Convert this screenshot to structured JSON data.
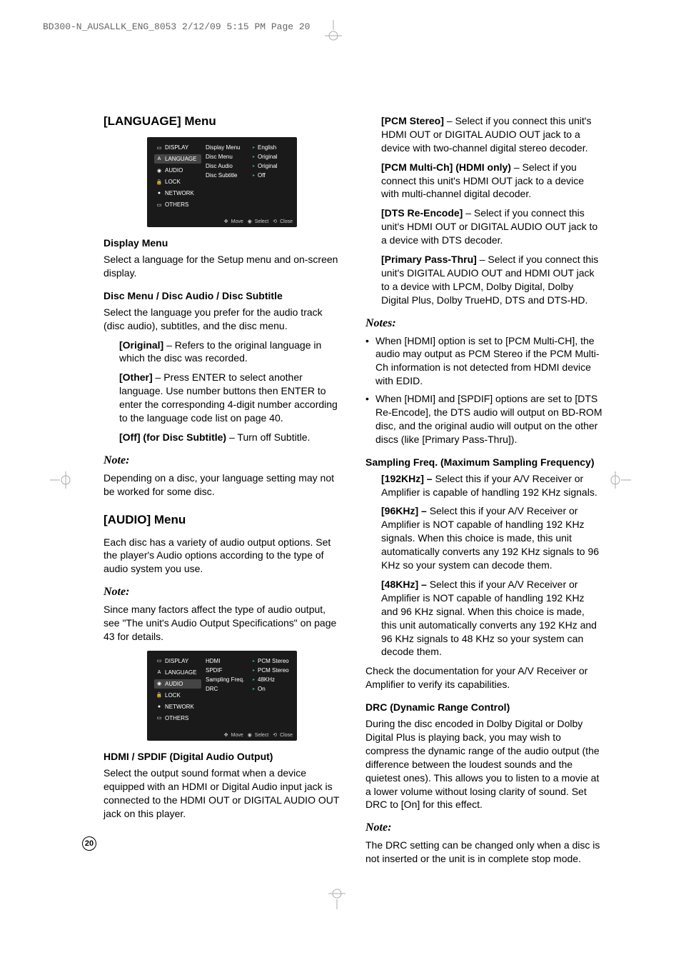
{
  "header": "BD300-N_AUSALLK_ENG_8053  2/12/09  5:15 PM  Page 20",
  "page_number": "20",
  "left": {
    "h_language": "[LANGUAGE] Menu",
    "menu1": {
      "side": [
        "DISPLAY",
        "LANGUAGE",
        "AUDIO",
        "LOCK",
        "NETWORK",
        "OTHERS"
      ],
      "mid": [
        "Display Menu",
        "Disc Menu",
        "Disc Audio",
        "Disc Subtitle"
      ],
      "right": [
        "English",
        "Original",
        "Original",
        "Off"
      ],
      "footer_move": "Move",
      "footer_select": "Select",
      "footer_close": "Close"
    },
    "dm_h": "Display Menu",
    "dm_p": "Select a language for the Setup menu and on-screen display.",
    "dmas_h": "Disc Menu / Disc Audio / Disc Subtitle",
    "dmas_p": "Select the language you prefer for the audio track (disc audio), subtitles, and the disc menu.",
    "orig_b": "[Original]",
    "orig_t": " – Refers to the original language in which the disc was recorded.",
    "other_b": "[Other]",
    "other_t": " – Press ENTER to select another language. Use number buttons then ENTER to enter the corresponding 4-digit number according to the language code list on page 40.",
    "off_b": "[Off] (for Disc Subtitle)",
    "off_t": " – Turn off Subtitle.",
    "note1_h": "Note:",
    "note1_p": "Depending on a disc, your language setting may not be worked for some disc.",
    "h_audio": "[AUDIO] Menu",
    "audio_p": "Each disc has a variety of audio output options. Set the player's Audio options according to the type of audio system you use.",
    "note2_h": "Note:",
    "note2_p": "Since many factors affect the type of audio output, see \"The unit's Audio Output Specifications\" on page 43 for details.",
    "menu2": {
      "side": [
        "DISPLAY",
        "LANGUAGE",
        "AUDIO",
        "LOCK",
        "NETWORK",
        "OTHERS"
      ],
      "mid": [
        "HDMI",
        "SPDIF",
        "Sampling Freq.",
        "DRC"
      ],
      "right": [
        "PCM Stereo",
        "PCM Stereo",
        "48KHz",
        "On"
      ],
      "footer_move": "Move",
      "footer_select": "Select",
      "footer_close": "Close"
    },
    "hs_h": "HDMI / SPDIF (Digital Audio Output)",
    "hs_p": "Select the output sound format when a device equipped with an HDMI or Digital Audio input jack is connected to the HDMI OUT or DIGITAL AUDIO OUT jack on this player."
  },
  "right": {
    "pcm_b": "[PCM Stereo]",
    "pcm_t": " – Select if you connect this unit's HDMI OUT or DIGITAL AUDIO OUT jack to a device with two-channel digital stereo decoder.",
    "pcmm_b": "[PCM Multi-Ch] (HDMI only)",
    "pcmm_t": " – Select if you connect this unit's HDMI OUT jack to a device with multi-channel digital decoder.",
    "dts_b": "[DTS Re-Encode]",
    "dts_t": " – Select if you connect this unit's HDMI OUT or DIGITAL AUDIO OUT jack to a device with DTS decoder.",
    "pri_b": "[Primary Pass-Thru]",
    "pri_t": " – Select if you connect this unit's DIGITAL AUDIO OUT and HDMI OUT jack to a device with LPCM, Dolby Digital, Dolby Digital Plus, Dolby TrueHD, DTS and DTS-HD.",
    "notes_h": "Notes:",
    "note_li1": "When [HDMI] option is set to [PCM Multi-CH], the audio may output as PCM Stereo if the PCM Multi-Ch information is not detected from HDMI device with EDID.",
    "note_li2": "When [HDMI] and [SPDIF] options are set to [DTS Re-Encode], the DTS audio will output on BD-ROM disc, and the original audio will output on the other discs (like [Primary Pass-Thru]).",
    "samp_h": "Sampling Freq. (Maximum Sampling Frequency)",
    "k192_b": "[192KHz] – ",
    "k192_t": "Select this if your A/V Receiver or Amplifier is capable of handling 192 KHz signals.",
    "k96_b": "[96KHz] – ",
    "k96_t": "Select this if your A/V Receiver or Amplifier is NOT capable of handling 192 KHz signals. When this choice is made, this unit automatically converts any 192 KHz signals to 96 KHz so your system can decode them.",
    "k48_b": "[48KHz] – ",
    "k48_t": "Select this if your A/V Receiver or Amplifier is NOT capable of handling 192 KHz and 96 KHz signal. When this choice is made, this unit automatically converts any 192 KHz and 96 KHz signals to 48 KHz so your system can decode them.",
    "check_p": "Check the documentation for your A/V Receiver or Amplifier to verify its capabilities.",
    "drc_h": "DRC (Dynamic Range Control)",
    "drc_p": "During the disc encoded in Dolby Digital or Dolby Digital Plus is playing back, you may wish to compress the dynamic range of the audio output (the difference between the loudest sounds and the quietest ones). This allows you to listen to a movie at a lower volume without losing clarity of sound. Set DRC to [On] for this effect.",
    "note3_h": "Note:",
    "note3_p": "The DRC setting can be changed only when a disc is not inserted or the unit is in complete stop mode."
  }
}
